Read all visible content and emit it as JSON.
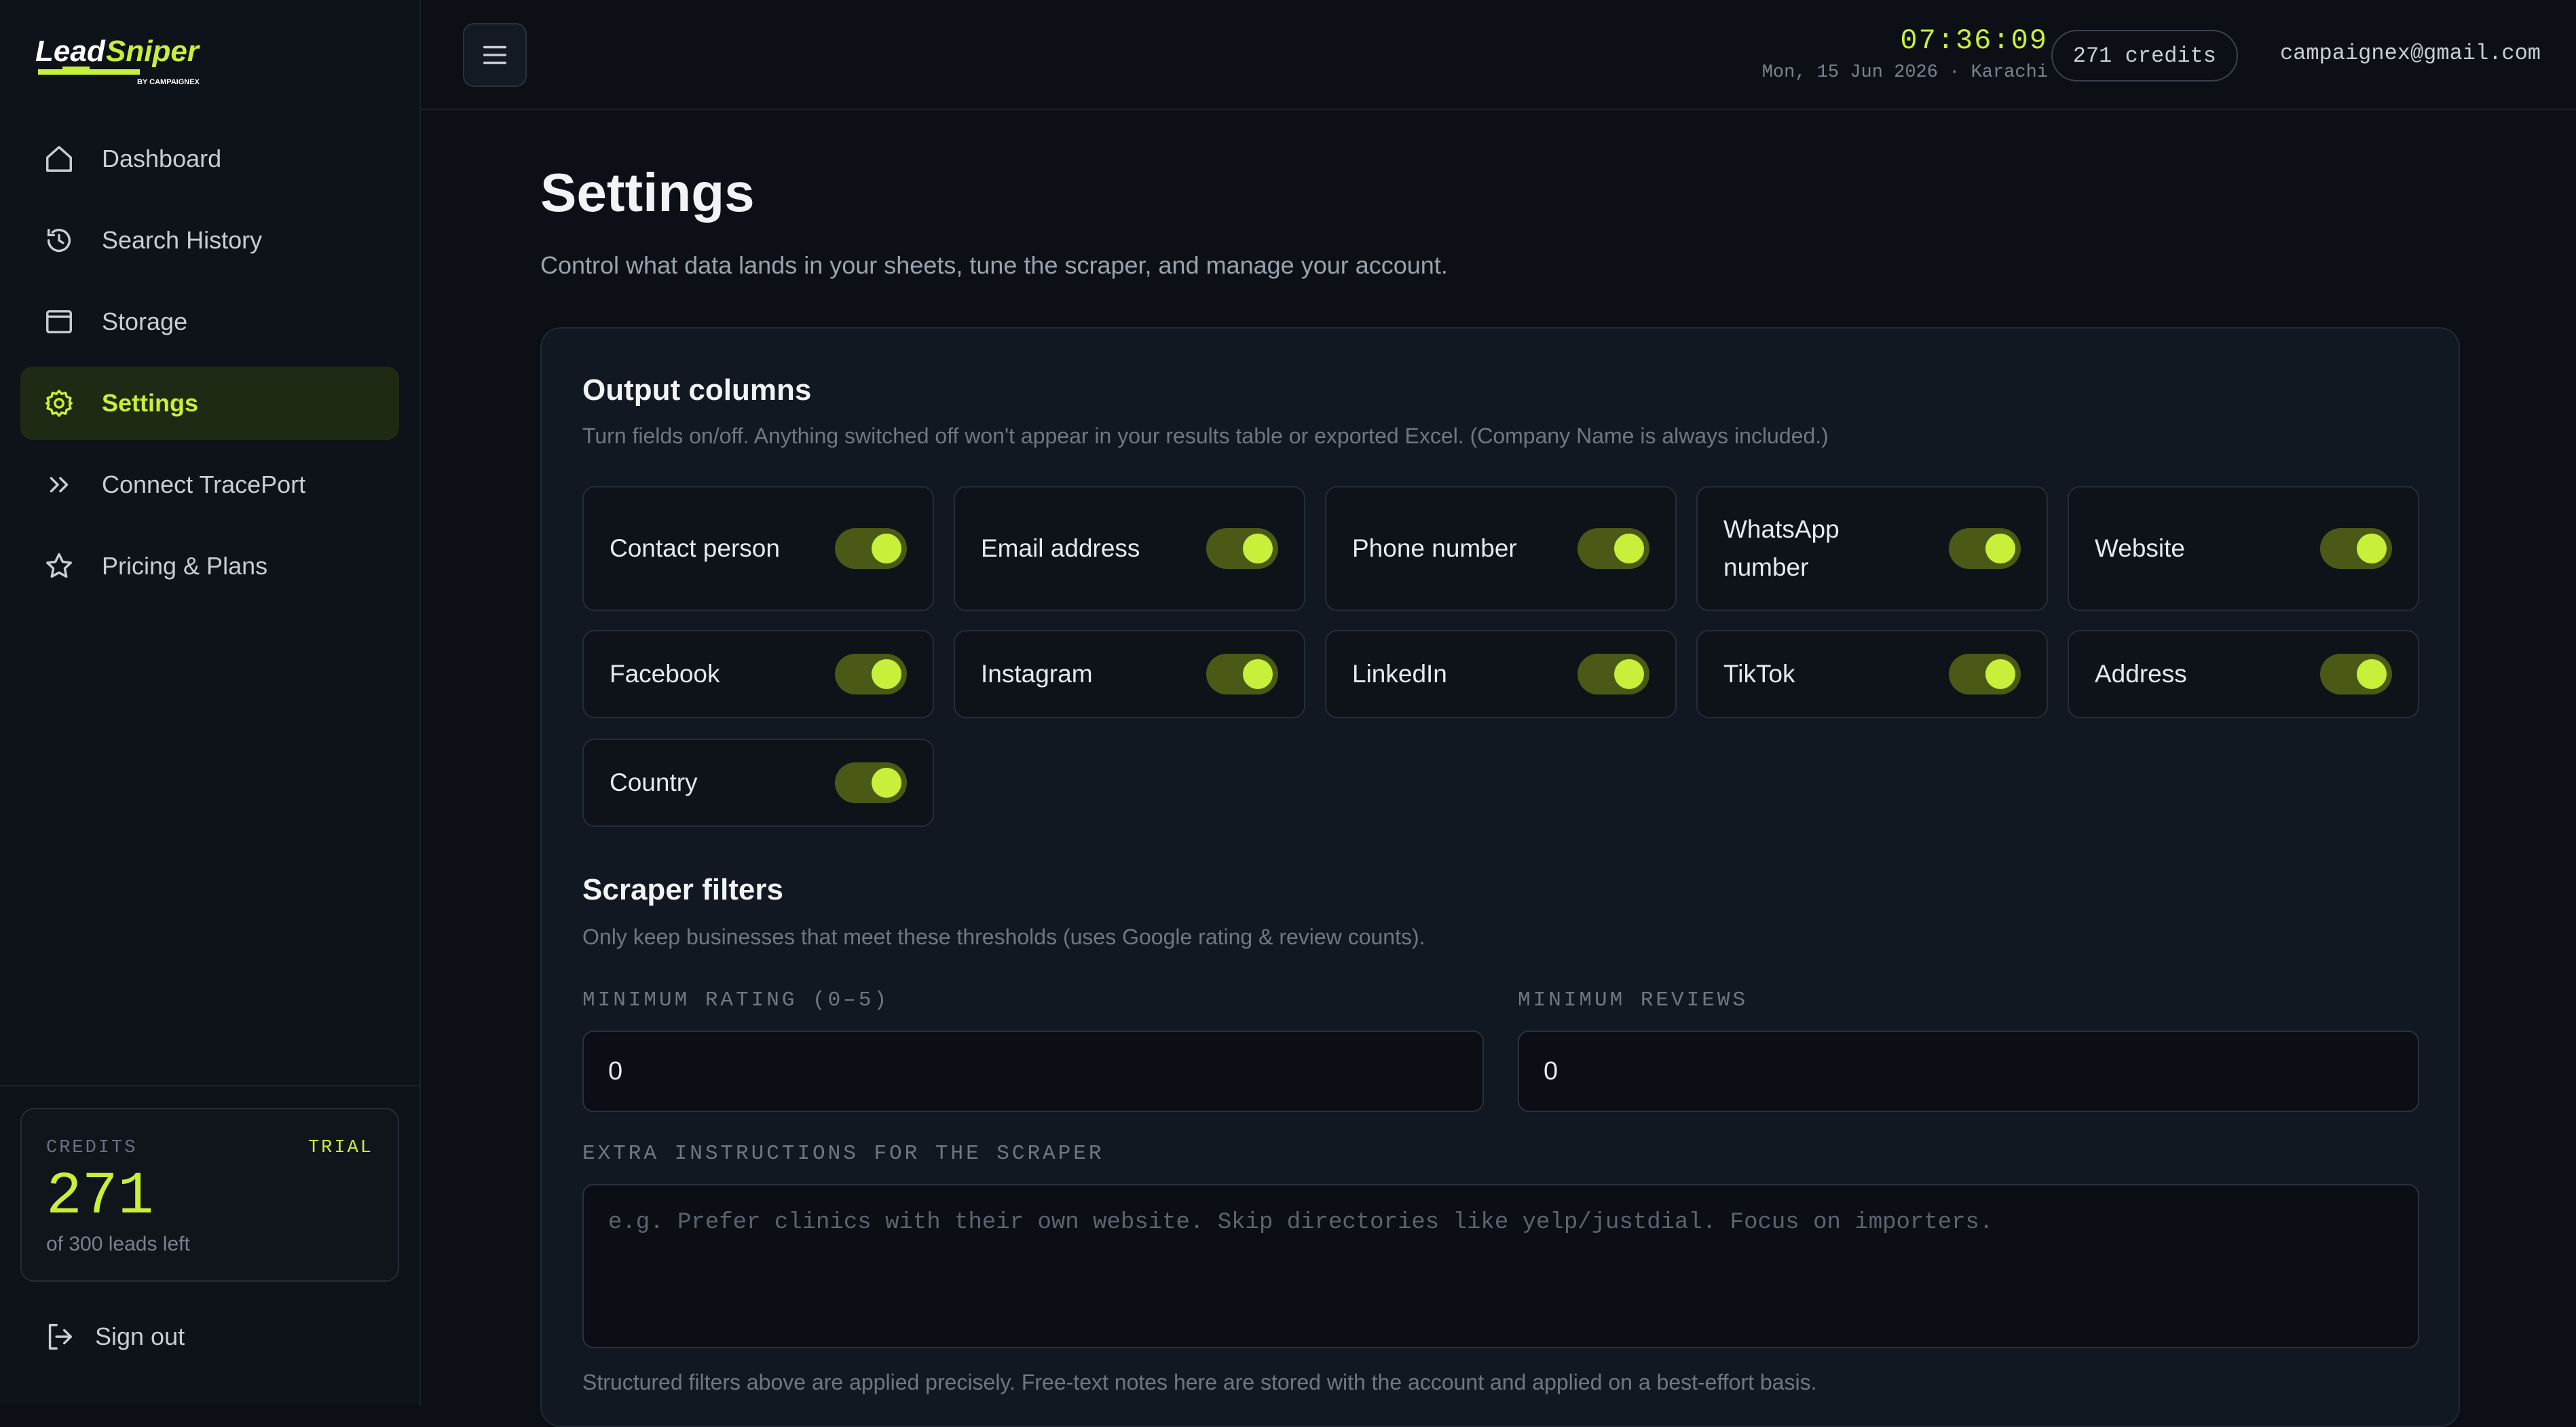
{
  "brand": {
    "name": "LeadSniper",
    "tagline": "BY CAMPAIGNEX",
    "accent": "#c8f03a"
  },
  "sidebar": {
    "items": [
      {
        "label": "Dashboard",
        "icon": "home-icon",
        "active": false
      },
      {
        "label": "Search History",
        "icon": "history-icon",
        "active": false
      },
      {
        "label": "Storage",
        "icon": "archive-icon",
        "active": false
      },
      {
        "label": "Settings",
        "icon": "gear-icon",
        "active": true
      },
      {
        "label": "Connect TracePort",
        "icon": "chevrons-right-icon",
        "active": false
      },
      {
        "label": "Pricing & Plans",
        "icon": "star-icon",
        "active": false
      }
    ],
    "credits": {
      "label": "CREDITS",
      "badge": "TRIAL",
      "count": "271",
      "sub": "of 300 leads left"
    },
    "signout_label": "Sign out"
  },
  "topbar": {
    "time": "07:36:09",
    "date": "Mon, 15 Jun 2026 · Karachi",
    "credits_pill": "271 credits",
    "email": "campaignex@gmail.com"
  },
  "page": {
    "title": "Settings",
    "subtitle": "Control what data lands in your sheets, tune the scraper, and manage your account."
  },
  "output_columns": {
    "title": "Output columns",
    "desc": "Turn fields on/off. Anything switched off won't appear in your results table or exported Excel. (Company Name is always included.)",
    "fields": [
      {
        "label": "Contact person",
        "on": true
      },
      {
        "label": "Email address",
        "on": true
      },
      {
        "label": "Phone number",
        "on": true
      },
      {
        "label": "WhatsApp number",
        "on": true
      },
      {
        "label": "Website",
        "on": true
      },
      {
        "label": "Facebook",
        "on": true
      },
      {
        "label": "Instagram",
        "on": true
      },
      {
        "label": "LinkedIn",
        "on": true
      },
      {
        "label": "TikTok",
        "on": true
      },
      {
        "label": "Address",
        "on": true
      },
      {
        "label": "Country",
        "on": true
      }
    ]
  },
  "scraper_filters": {
    "title": "Scraper filters",
    "desc": "Only keep businesses that meet these thresholds (uses Google rating & review counts).",
    "min_rating_label": "MINIMUM RATING (0–5)",
    "min_rating_value": "0",
    "min_reviews_label": "MINIMUM REVIEWS",
    "min_reviews_value": "0",
    "extra_label": "EXTRA INSTRUCTIONS FOR THE SCRAPER",
    "extra_placeholder": "e.g. Prefer clinics with their own website. Skip directories like yelp/justdial. Focus on importers.",
    "note": "Structured filters above are applied precisely. Free-text notes here are stored with the account and applied on a best-effort basis."
  }
}
